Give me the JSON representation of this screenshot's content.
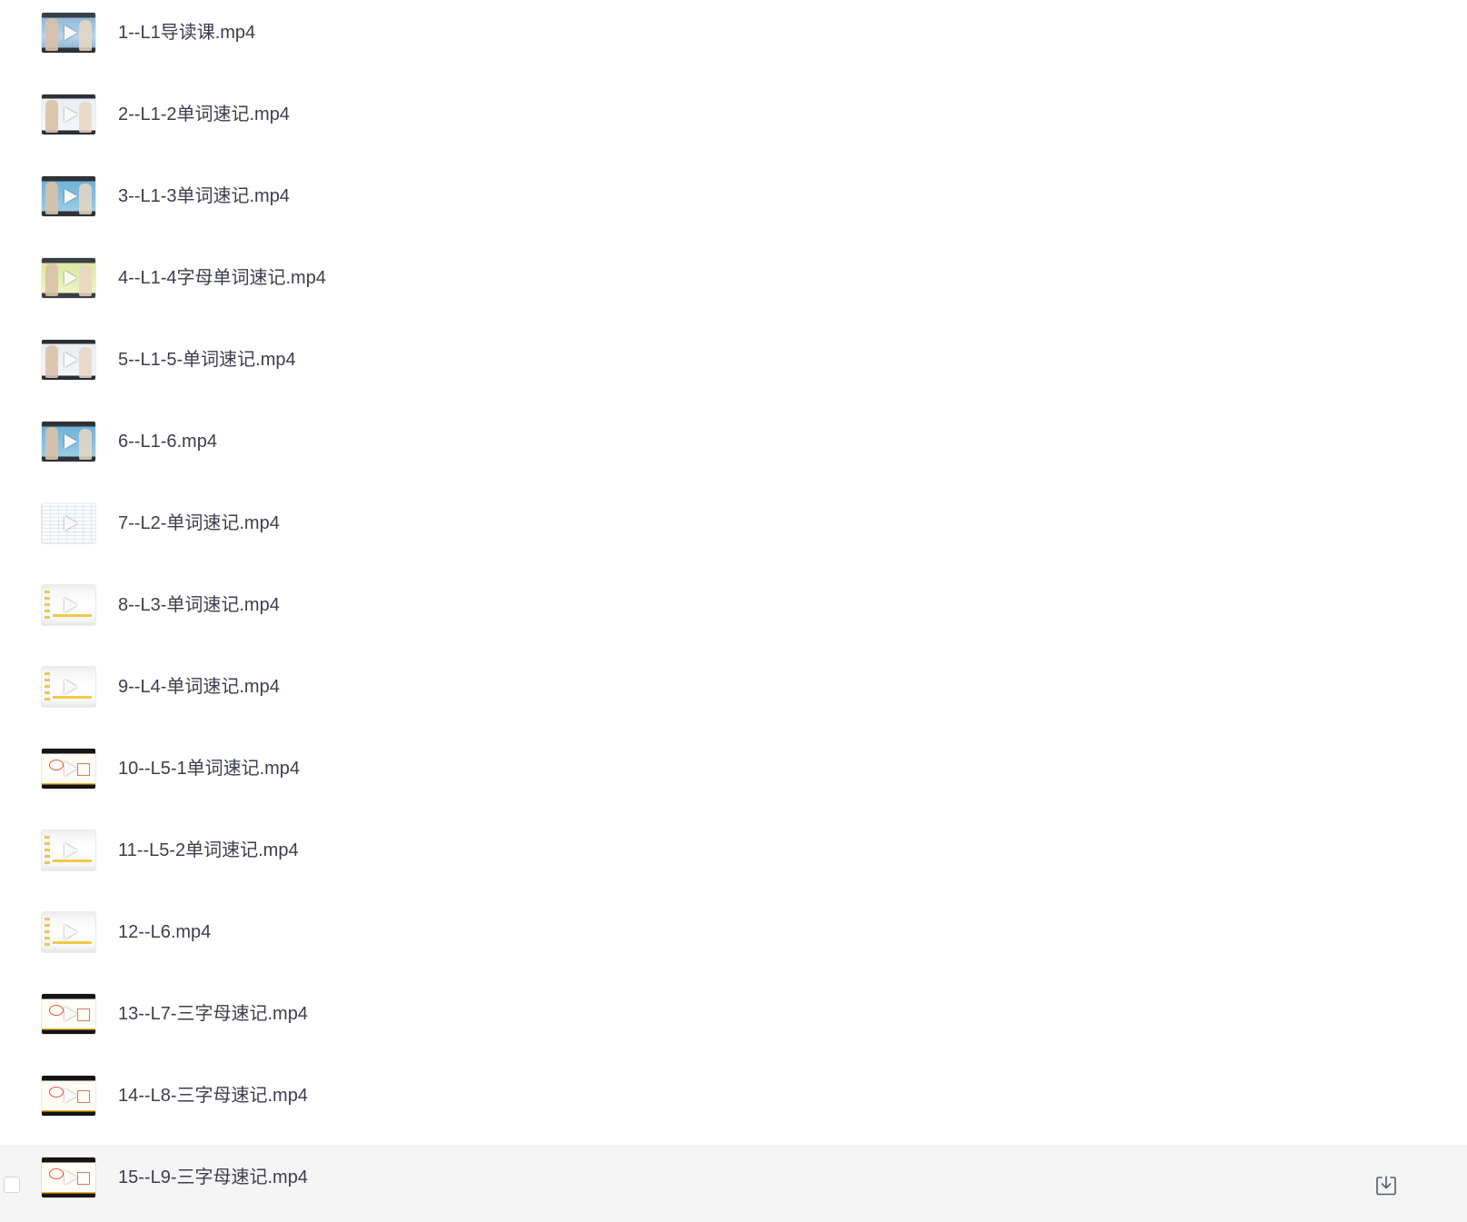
{
  "files": [
    {
      "name": "1--L1导读课.mp4",
      "thumb": "live"
    },
    {
      "name": "2--L1-2单词速记.mp4",
      "thumb": "live v2"
    },
    {
      "name": "3--L1-3单词速记.mp4",
      "thumb": "live v3"
    },
    {
      "name": "4--L1-4字母单词速记.mp4",
      "thumb": "live v4"
    },
    {
      "name": "5--L1-5-单词速记.mp4",
      "thumb": "live v2"
    },
    {
      "name": "6--L1-6.mp4",
      "thumb": "live v3"
    },
    {
      "name": "7--L2-单词速记.mp4",
      "thumb": "sheet"
    },
    {
      "name": "8--L3-单词速记.mp4",
      "thumb": "slide"
    },
    {
      "name": "9--L4-单词速记.mp4",
      "thumb": "slide"
    },
    {
      "name": "10--L5-1单词速记.mp4",
      "thumb": "dark"
    },
    {
      "name": "11--L5-2单词速记.mp4",
      "thumb": "slide"
    },
    {
      "name": "12--L6.mp4",
      "thumb": "slide"
    },
    {
      "name": "13--L7-三字母速记.mp4",
      "thumb": "dark"
    },
    {
      "name": "14--L8-三字母速记.mp4",
      "thumb": "dark"
    },
    {
      "name": "15--L9-三字母速记.mp4",
      "thumb": "dark",
      "hovered": true
    }
  ],
  "icons": {
    "thumbnail_overlay": "play-icon",
    "row_action": "download-icon",
    "row_select": "checkbox"
  },
  "colors": {
    "text": "#3c3e4d",
    "hover_background": "#f5f5f6",
    "icon": "#555a66"
  }
}
